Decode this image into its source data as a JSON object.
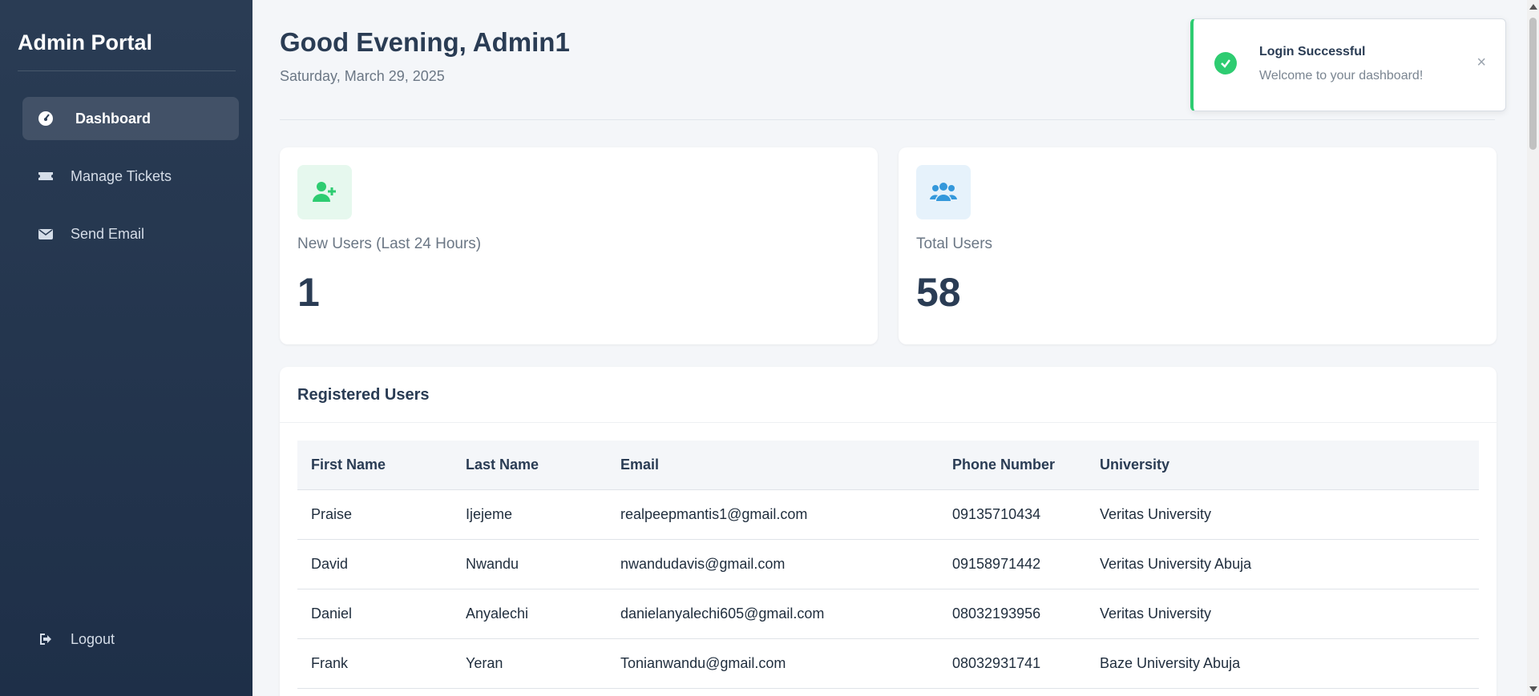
{
  "sidebar": {
    "brand": "Admin Portal",
    "items": [
      {
        "label": "Dashboard",
        "icon": "gauge-icon"
      },
      {
        "label": "Manage Tickets",
        "icon": "ticket-icon"
      },
      {
        "label": "Send Email",
        "icon": "envelope-icon"
      }
    ],
    "logout": {
      "label": "Logout",
      "icon": "logout-icon"
    }
  },
  "header": {
    "greeting": "Good Evening, Admin1",
    "date": "Saturday, March 29, 2025"
  },
  "stats": {
    "new_users": {
      "label": "New Users (Last 24 Hours)",
      "value": "1",
      "icon": "user-plus-icon",
      "color": "#2ecc71"
    },
    "total_users": {
      "label": "Total Users",
      "value": "58",
      "icon": "users-icon",
      "color": "#3498db"
    }
  },
  "users_table": {
    "title": "Registered Users",
    "columns": [
      "First Name",
      "Last Name",
      "Email",
      "Phone Number",
      "University"
    ],
    "rows": [
      [
        "Praise",
        "Ijejeme",
        "realpeepmantis1@gmail.com",
        "09135710434",
        "Veritas University"
      ],
      [
        "David",
        "Nwandu",
        "nwandudavis@gmail.com",
        "09158971442",
        "Veritas University Abuja"
      ],
      [
        "Daniel",
        "Anyalechi",
        "danielanyalechi605@gmail.com",
        "08032193956",
        "Veritas University"
      ],
      [
        "Frank",
        "Yeran",
        "Tonianwandu@gmail.com",
        "08032931741",
        "Baze University Abuja"
      ]
    ]
  },
  "toast": {
    "title": "Login Successful",
    "message": "Welcome to your dashboard!",
    "close": "×",
    "accent": "#2ecc71"
  }
}
